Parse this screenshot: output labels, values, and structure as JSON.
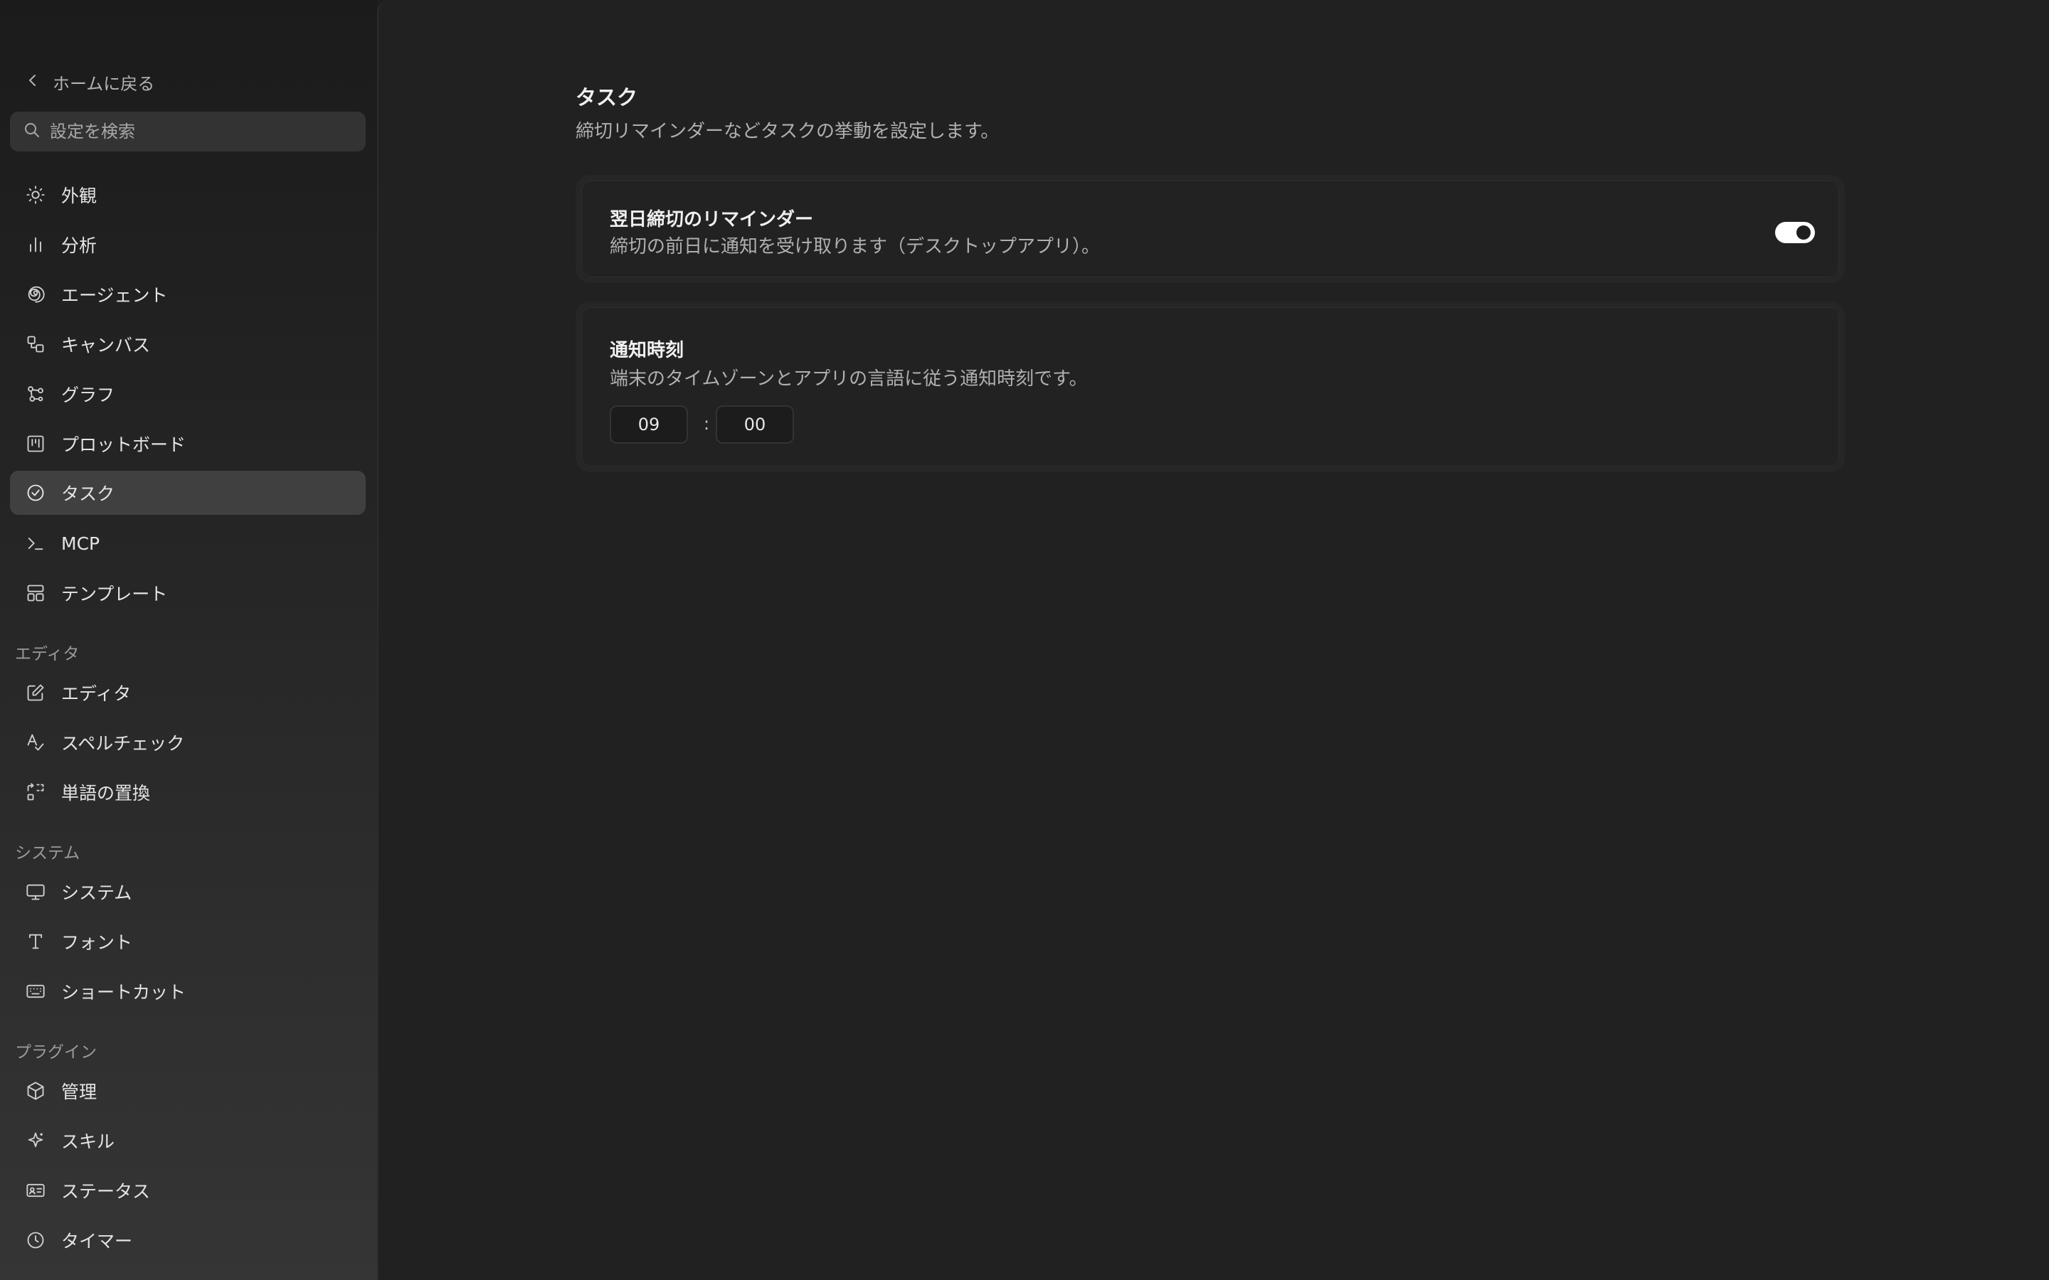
{
  "sidebar": {
    "back_label": "ホームに戻る",
    "search_placeholder": "設定を検索",
    "items": [
      {
        "label": "外観",
        "icon": "sun-icon"
      },
      {
        "label": "分析",
        "icon": "bar-chart-icon"
      },
      {
        "label": "エージェント",
        "icon": "spiral-icon"
      },
      {
        "label": "キャンバス",
        "icon": "canvas-icon"
      },
      {
        "label": "グラフ",
        "icon": "graph-icon"
      },
      {
        "label": "プロットボード",
        "icon": "kanban-icon"
      },
      {
        "label": "タスク",
        "icon": "check-circle-icon",
        "active": true
      },
      {
        "label": "MCP",
        "icon": "terminal-icon"
      },
      {
        "label": "テンプレート",
        "icon": "layout-icon"
      }
    ],
    "sections": {
      "editor": {
        "title": "エディタ",
        "items": [
          {
            "label": "エディタ",
            "icon": "edit-icon"
          },
          {
            "label": "スペルチェック",
            "icon": "spell-check-icon"
          },
          {
            "label": "単語の置換",
            "icon": "replace-icon"
          }
        ]
      },
      "system": {
        "title": "システム",
        "items": [
          {
            "label": "システム",
            "icon": "monitor-icon"
          },
          {
            "label": "フォント",
            "icon": "type-icon"
          },
          {
            "label": "ショートカット",
            "icon": "keyboard-icon"
          }
        ]
      },
      "plugins": {
        "title": "プラグイン",
        "items": [
          {
            "label": "管理",
            "icon": "box-icon"
          },
          {
            "label": "スキル",
            "icon": "sparkle-icon"
          },
          {
            "label": "ステータス",
            "icon": "id-card-icon"
          },
          {
            "label": "タイマー",
            "icon": "clock-icon"
          }
        ]
      }
    }
  },
  "main": {
    "title": "タスク",
    "subtitle": "締切リマインダーなどタスクの挙動を設定します。",
    "reminder": {
      "title": "翌日締切のリマインダー",
      "description": "締切の前日に通知を受け取ります（デスクトップアプリ）。",
      "enabled": true
    },
    "notify_time": {
      "title": "通知時刻",
      "description": "端末のタイムゾーンとアプリの言語に従う通知時刻です。",
      "hour": "09",
      "separator": ":",
      "minute": "00"
    }
  }
}
